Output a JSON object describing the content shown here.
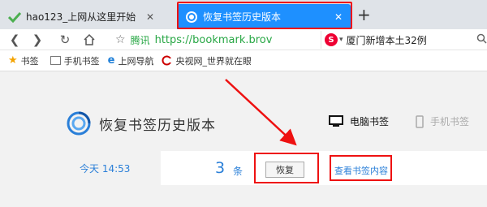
{
  "tabs": [
    {
      "label": "hao123_上网从这里开始",
      "close": "✕"
    },
    {
      "label": "恢复书签历史版本",
      "close": "✕"
    }
  ],
  "new_tab": "+",
  "nav": {
    "site_name": "腾讯",
    "url": "https://bookmark.brov"
  },
  "search": {
    "engine_glyph": "S",
    "caret": "▾",
    "text": "厦门新增本土32例"
  },
  "bookmarks": [
    {
      "label": "书签"
    },
    {
      "label": "手机书签"
    },
    {
      "label": "上网导航"
    },
    {
      "label": "央视网_世界就在眼前"
    }
  ],
  "page": {
    "title": "恢复书签历史版本",
    "pc_tab": "电脑书签",
    "mobile_tab": "手机书签",
    "date": "今天 14:53",
    "count": "3",
    "count_unit": "条",
    "restore_button": "恢复",
    "view_link": "查看书签内容"
  },
  "colors": {
    "accent": "#1e90ff",
    "highlight": "#e11111",
    "link": "#2a7fd8",
    "secure_url": "#28a745"
  }
}
